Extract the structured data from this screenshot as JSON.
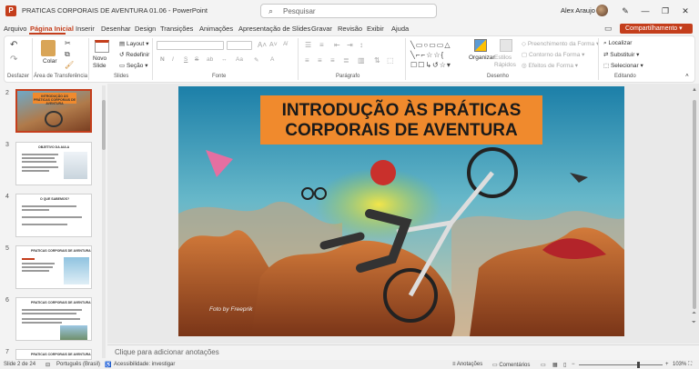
{
  "app": {
    "doc_title": "PRATICAS CORPORAIS DE AVENTURA 01.06  -  PowerPoint",
    "search_placeholder": "Pesquisar",
    "user_name": "Alex Araujo",
    "win_controls": [
      "—",
      "❐",
      "✕"
    ]
  },
  "menu": {
    "tabs": [
      "Arquivo",
      "Página Inicial",
      "Inserir",
      "Desenhar",
      "Design",
      "Transições",
      "Animações",
      "Apresentação de Slides",
      "Gravar",
      "Revisão",
      "Exibir",
      "Ajuda"
    ],
    "share_label": "Compartilhamento"
  },
  "ribbon": {
    "groups": {
      "undo": "Desfazer",
      "clipboard": "Área de Transferência",
      "slides": "Slides",
      "font": "Fonte",
      "paragraph": "Parágrafo",
      "drawing": "Desenho",
      "editing": "Editando"
    },
    "clipboard": {
      "paste": "Colar"
    },
    "slides": {
      "new_slide": "Novo Slide",
      "layout": "Layout",
      "reset": "Redefinir",
      "section": "Seção"
    },
    "font": {
      "bold": "N",
      "italic": "I",
      "underline": "S",
      "strike": "S",
      "subscript": "ab",
      "size_up": "A",
      "size_down": "A"
    },
    "drawing": {
      "arrange": "Organizar",
      "quick_styles": "Estilos Rápidos",
      "fill": "Preenchimento da Forma",
      "outline": "Contorno da Forma",
      "effects": "Efeitos de Forma"
    },
    "editing": {
      "find": "Localizar",
      "replace": "Substituir",
      "select": "Selecionar"
    }
  },
  "thumbnails": [
    {
      "num": "2",
      "title": "INTRODUÇÃO ÀS PRÁTICAS CORPORAIS DE AVENTURA"
    },
    {
      "num": "3",
      "title": "OBJETIVO DA AULA"
    },
    {
      "num": "4",
      "title": "O QUE SABEMOS?"
    },
    {
      "num": "5",
      "title": "PRATICAS CORPORAIS DE AVENTURA"
    },
    {
      "num": "6",
      "title": "PRATICAS CORPORAIS DE AVENTURA"
    },
    {
      "num": "7",
      "title": "PRATICAS CORPORAIS DE AVENTURA"
    }
  ],
  "slide": {
    "title": "INTRODUÇÃO ÀS PRÁTICAS CORPORAIS DE AVENTURA",
    "credit": "Foto by Freeprik"
  },
  "notes_placeholder": "Clique para adicionar anotações",
  "status": {
    "slide_count": "Slide 2 de 24",
    "language": "Português (Brasil)",
    "accessibility": "Acessibilidade: investigar",
    "notes": "Anotações",
    "comments": "Comentários",
    "zoom": "103%"
  },
  "colors": {
    "accent": "#c43e1c",
    "title_box": "#f08a2d"
  }
}
